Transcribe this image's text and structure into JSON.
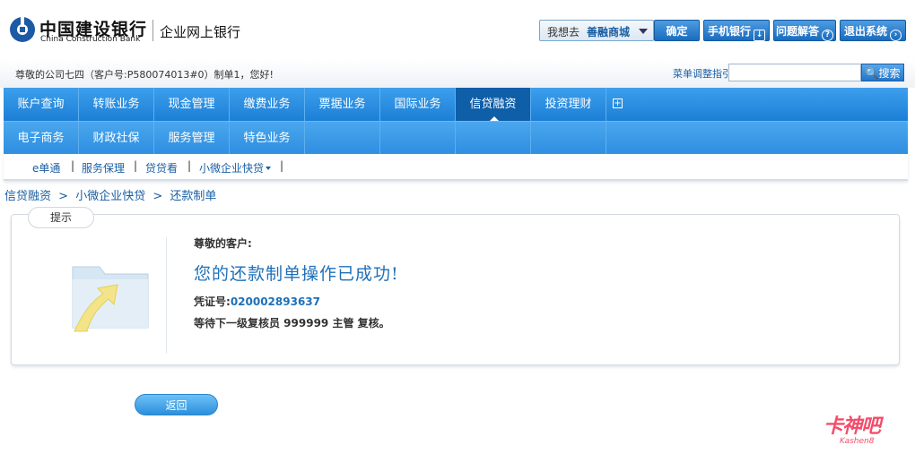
{
  "header": {
    "bank_name_cn": "中国建设银行",
    "bank_name_en": "China Construction Bank",
    "subtitle": "企业网上银行",
    "goto_label": "我想去",
    "goto_value": "善融商城",
    "confirm_label": "确定",
    "mobile_bank_label": "手机银行",
    "help_label": "问题解答",
    "exit_label": "退出系统"
  },
  "userbar": {
    "greeting": "尊敬的公司七四（客户号:P580074013#0）制单1，您好!",
    "menu_guide": "菜单调整指引",
    "search_placeholder": "",
    "search_label": "搜索"
  },
  "nav": {
    "row1": [
      "账户查询",
      "转账业务",
      "现金管理",
      "缴费业务",
      "票据业务",
      "国际业务",
      "信贷融资",
      "投资理财"
    ],
    "row2": [
      "电子商务",
      "财政社保",
      "服务管理",
      "特色业务"
    ],
    "active": "信贷融资"
  },
  "subnav": {
    "items": [
      "e单通",
      "服务保理",
      "贷贷看",
      "小微企业快贷"
    ]
  },
  "breadcrumb": [
    "信贷融资",
    ">",
    "小微企业快贷",
    ">",
    "还款制单"
  ],
  "panel": {
    "tab_label": "提示",
    "dear": "尊敬的客户:",
    "success_msg": "您的还款制单操作已成功!",
    "voucher_label": "凭证号:",
    "voucher_no": "020002893637",
    "wait_msg": "等待下一级复核员 999999 主管 复核。"
  },
  "back_label": "返回",
  "watermark": {
    "main": "卡神吧",
    "sub": "Kashen8"
  },
  "colors": {
    "nav_blue": "#1c7fd6",
    "link_blue": "#1a5fa4",
    "success_blue": "#1e70b8"
  }
}
